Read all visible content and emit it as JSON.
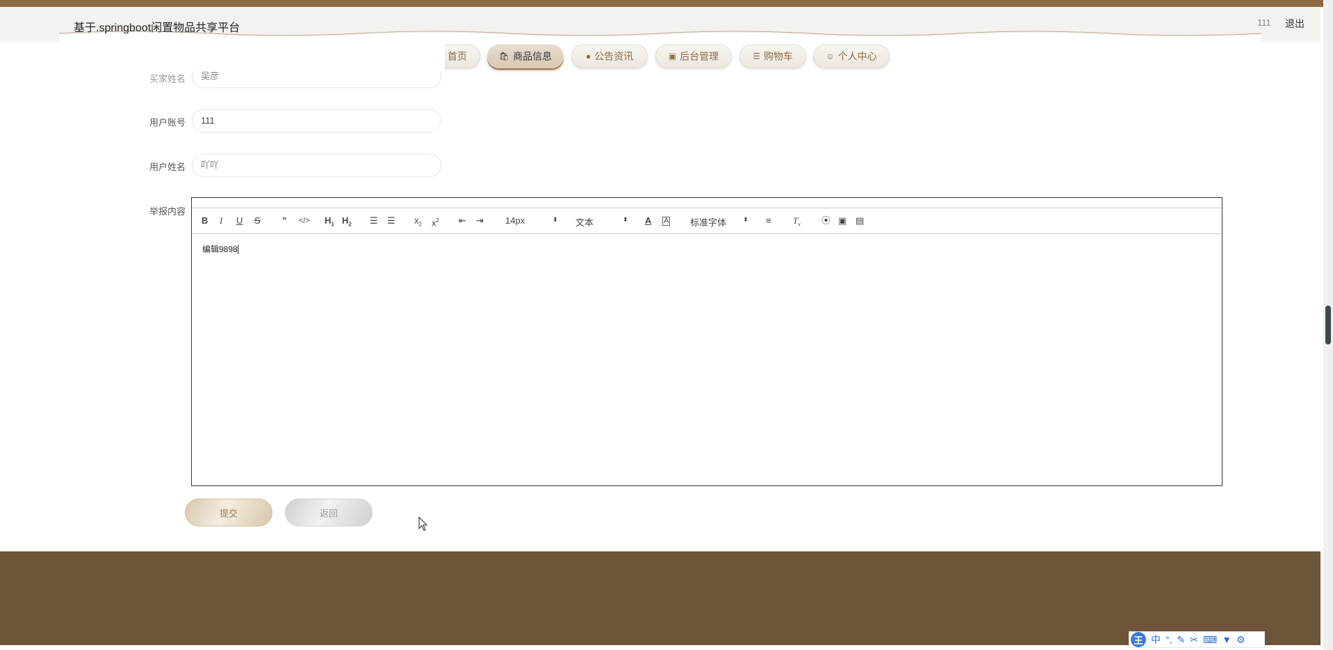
{
  "header": {
    "site_title": "基于.springboot闲置物品共享平台",
    "user_name": "111",
    "logout_label": "退出"
  },
  "nav": {
    "items": [
      {
        "label": "首页",
        "icon": "star-icon"
      },
      {
        "label": "商品信息",
        "icon": "bag-icon",
        "active": true
      },
      {
        "label": "公告资讯",
        "icon": "info-icon"
      },
      {
        "label": "后台管理",
        "icon": "briefcase-icon"
      },
      {
        "label": "购物车",
        "icon": "cart-icon"
      },
      {
        "label": "个人中心",
        "icon": "user-icon"
      }
    ]
  },
  "form": {
    "partial_field_label": "买家姓名",
    "partial_field_value": "吴彦",
    "account_label": "用户账号",
    "account_value": "111",
    "name_label": "用户姓名",
    "name_value": "吖吖",
    "content_label": "举报内容"
  },
  "editor": {
    "font_size": "14px",
    "header_select": "文本",
    "font_family": "标准字体",
    "content": "编辑9898",
    "toolbar_icons": [
      "bold-icon",
      "italic-icon",
      "underline-icon",
      "strike-icon",
      "blockquote-icon",
      "code-icon",
      "h1-icon",
      "h2-icon",
      "ordered-list-icon",
      "bullet-list-icon",
      "subscript-icon",
      "superscript-icon",
      "outdent-icon",
      "indent-icon",
      "font-color-icon",
      "background-color-icon",
      "align-icon",
      "clear-format-icon",
      "link-icon",
      "image-icon",
      "video-icon"
    ]
  },
  "buttons": {
    "submit_label": "提交",
    "back_label": "返回"
  },
  "ime": {
    "logo": "王",
    "mode": "中"
  }
}
